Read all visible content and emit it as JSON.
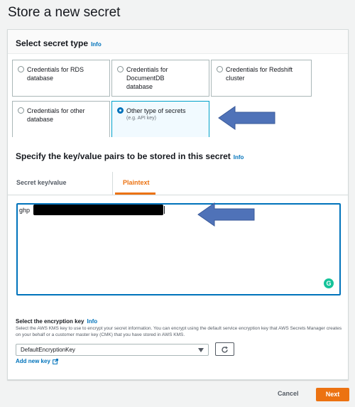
{
  "page": {
    "title": "Store a new secret"
  },
  "secret_type": {
    "heading": "Select secret type",
    "info": "Info",
    "options": [
      {
        "label": "Credentials for RDS database",
        "sub": "",
        "selected": false
      },
      {
        "label": "Credentials for DocumentDB database",
        "sub": "",
        "selected": false
      },
      {
        "label": "Credentials for Redshift cluster",
        "sub": "",
        "selected": false
      },
      {
        "label": "Credentials for other database",
        "sub": "",
        "selected": false
      },
      {
        "label": "Other type of secrets",
        "sub": "(e.g. API key)",
        "selected": true
      }
    ]
  },
  "kv": {
    "heading": "Specify the key/value pairs to be stored in this secret",
    "info": "Info",
    "tabs": [
      {
        "label": "Secret key/value",
        "active": false
      },
      {
        "label": "Plaintext",
        "active": true
      }
    ],
    "plaintext_value": "ghp"
  },
  "encryption": {
    "label": "Select the encryption key",
    "info": "Info",
    "description": "Select the AWS KMS key to use to encrypt your secret information. You can encrypt using the default service encryption key that AWS Secrets Manager creates on your behalf or a customer master key (CMK) that you have stored in AWS KMS.",
    "selected": "DefaultEncryptionKey",
    "add_new_key": "Add new key"
  },
  "footer": {
    "cancel": "Cancel",
    "next": "Next"
  },
  "colors": {
    "accent": "#ec7211",
    "link": "#0073bb",
    "annotation_arrow": "#4f72b8"
  }
}
